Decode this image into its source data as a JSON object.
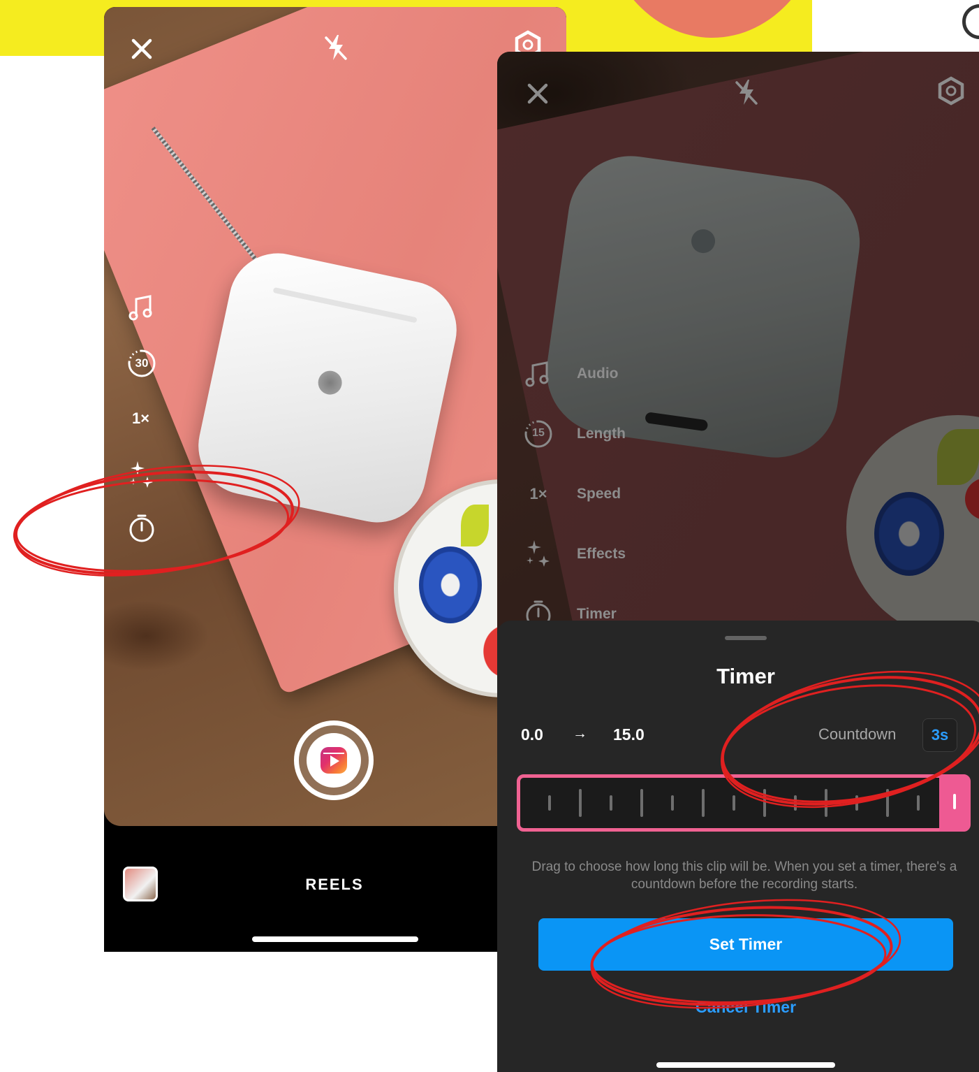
{
  "colors": {
    "accent_blue": "#0a95f5",
    "accent_pink": "#f06292",
    "annotation_red": "#e02020",
    "banner_yellow": "#f5ec1f"
  },
  "left_screen": {
    "top_bar": {
      "close_icon": "close-icon",
      "flash_icon": "flash-off-icon",
      "settings_icon": "settings-gear-icon"
    },
    "side_tools": [
      {
        "icon": "music-note-icon"
      },
      {
        "icon": "length-timer-icon",
        "value": "30"
      },
      {
        "icon": "speed-icon",
        "value": "1×"
      },
      {
        "icon": "effects-sparkle-icon"
      },
      {
        "icon": "timer-stopwatch-icon"
      }
    ],
    "record_button_icon": "reels-icon",
    "mode_label": "REELS"
  },
  "right_screen": {
    "top_bar": {
      "close_icon": "close-icon",
      "flash_icon": "flash-off-icon",
      "settings_icon": "settings-gear-icon"
    },
    "tool_menu": [
      {
        "icon": "music-note-icon",
        "label": "Audio"
      },
      {
        "icon": "length-timer-icon",
        "value": "15",
        "label": "Length"
      },
      {
        "icon": "speed-icon",
        "value": "1×",
        "label": "Speed"
      },
      {
        "icon": "effects-sparkle-icon",
        "label": "Effects"
      },
      {
        "icon": "timer-stopwatch-icon",
        "label": "Timer"
      }
    ],
    "timer_sheet": {
      "title": "Timer",
      "range_start": "0.0",
      "range_arrow": "→",
      "range_end": "15.0",
      "countdown_label": "Countdown",
      "countdown_value": "3s",
      "help_text": "Drag to choose how long this clip will be. When you set a timer, there's a countdown before the recording starts.",
      "set_timer_label": "Set Timer",
      "cancel_timer_label": "Cancel Timer"
    }
  }
}
